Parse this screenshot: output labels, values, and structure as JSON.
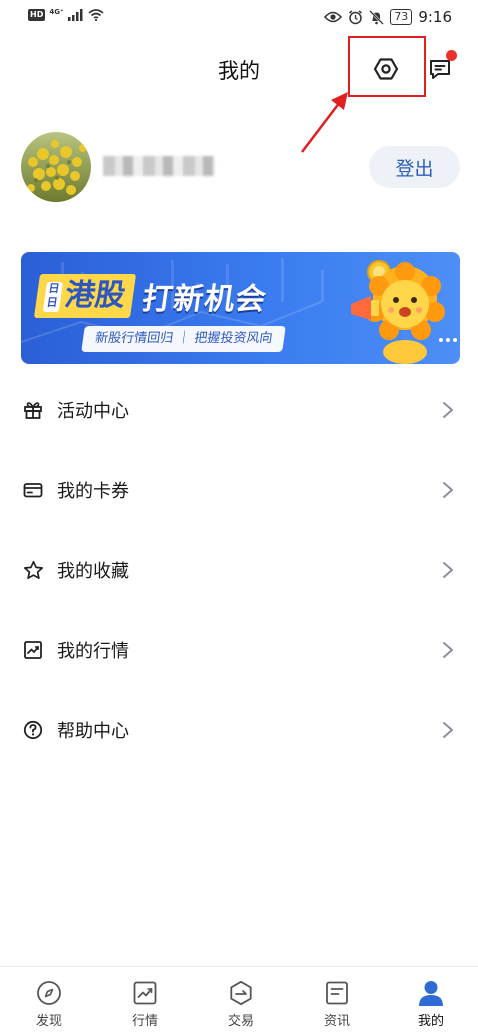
{
  "status_bar": {
    "hd": "HD",
    "network": "4G⁺",
    "battery": "73",
    "time": "9:16"
  },
  "header": {
    "title": "我的"
  },
  "profile": {
    "logout_label": "登出"
  },
  "banner": {
    "icon_text": "日日",
    "title_highlight": "港股",
    "title_rest": "打新机会",
    "subtitle": "新股行情回归 ｜ 把握投资风向"
  },
  "menu": {
    "items": [
      {
        "label": "活动中心",
        "icon": "gift-icon"
      },
      {
        "label": "我的卡券",
        "icon": "card-icon"
      },
      {
        "label": "我的收藏",
        "icon": "star-icon"
      },
      {
        "label": "我的行情",
        "icon": "chart-icon"
      },
      {
        "label": "帮助中心",
        "icon": "help-icon"
      }
    ]
  },
  "bottom_nav": {
    "items": [
      {
        "label": "发现",
        "icon": "compass-icon"
      },
      {
        "label": "行情",
        "icon": "market-icon"
      },
      {
        "label": "交易",
        "icon": "trade-icon"
      },
      {
        "label": "资讯",
        "icon": "news-icon"
      },
      {
        "label": "我的",
        "icon": "profile-icon",
        "active": true
      }
    ]
  },
  "colors": {
    "accent": "#2c5fb8",
    "highlight_red": "#e02020",
    "active_nav": "#2f6bd6"
  }
}
